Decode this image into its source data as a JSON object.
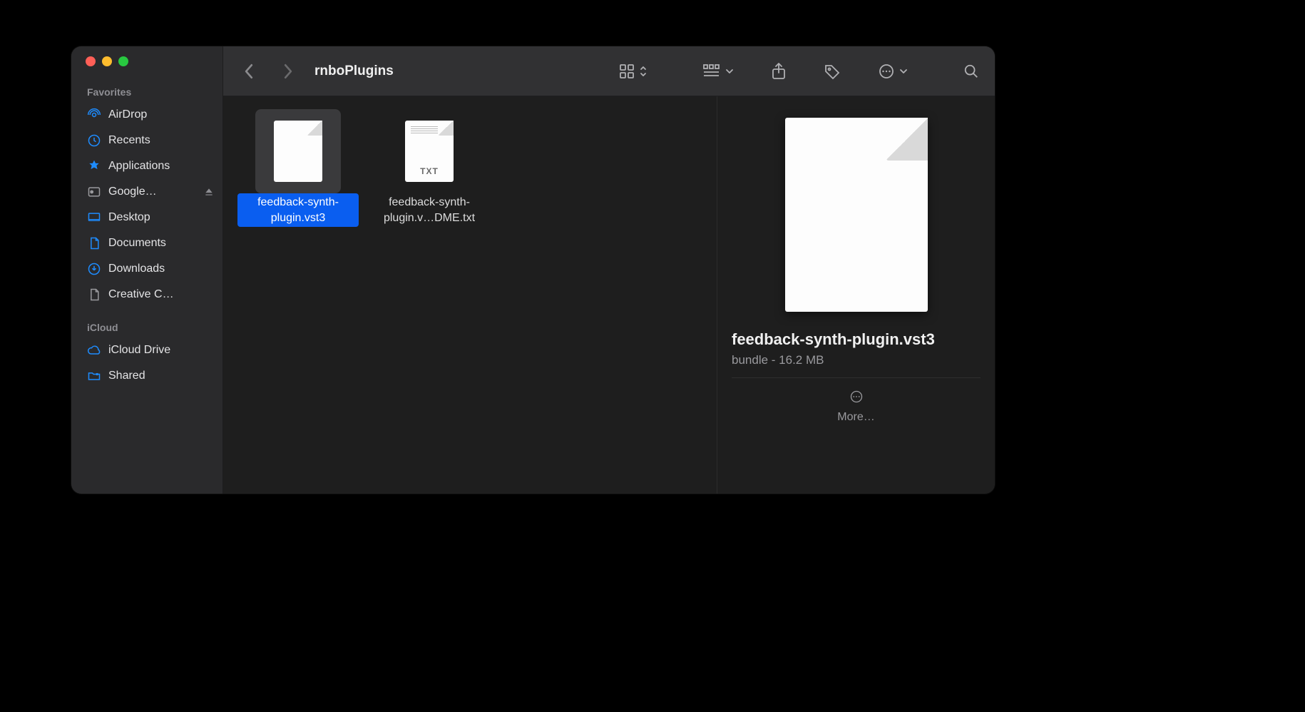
{
  "window": {
    "title": "rnboPlugins"
  },
  "sidebar": {
    "sections": [
      {
        "label": "Favorites",
        "items": [
          {
            "icon": "airdrop",
            "label": "AirDrop"
          },
          {
            "icon": "clock",
            "label": "Recents"
          },
          {
            "icon": "apps",
            "label": "Applications"
          },
          {
            "icon": "gdrive",
            "label": "Google…",
            "eject": true
          },
          {
            "icon": "desktop",
            "label": "Desktop"
          },
          {
            "icon": "doc",
            "label": "Documents"
          },
          {
            "icon": "download",
            "label": "Downloads"
          },
          {
            "icon": "docgray",
            "label": "Creative C…"
          }
        ]
      },
      {
        "label": "iCloud",
        "items": [
          {
            "icon": "cloud",
            "label": "iCloud Drive"
          },
          {
            "icon": "shared",
            "label": "Shared"
          }
        ]
      }
    ]
  },
  "files": [
    {
      "name": "feedback-synth-plugin.vst3",
      "type": "generic",
      "selected": true
    },
    {
      "name": "feedback-synth-plugin.v…DME.txt",
      "type": "txt",
      "selected": false
    }
  ],
  "preview": {
    "name": "feedback-synth-plugin.vst3",
    "meta": "bundle - 16.2 MB",
    "more_label": "More…"
  }
}
